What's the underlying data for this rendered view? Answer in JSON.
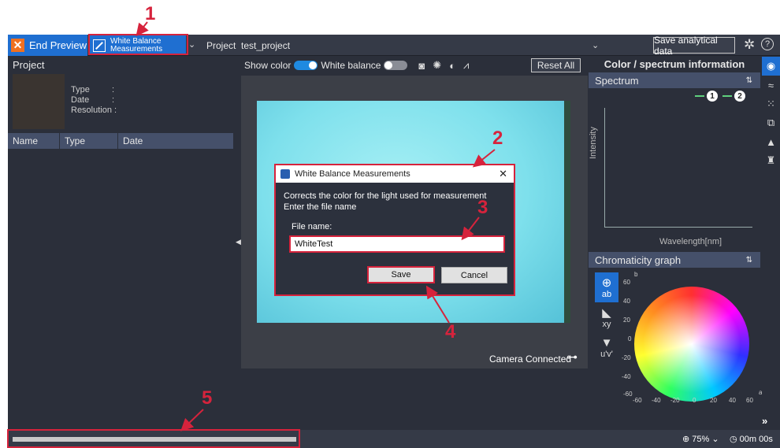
{
  "topbar": {
    "end_preview_label": "End Preview",
    "white_balance_label_line1": "White Balance",
    "white_balance_label_line2": "Measurements",
    "project_label": "Project",
    "project_name": "test_project",
    "save_analytical_label": "Save analytical data"
  },
  "left_panel": {
    "title": "Project",
    "meta": {
      "type_label": "Type",
      "date_label": "Date",
      "resolution_label": "Resolution :",
      "type_sep": ":",
      "date_sep": ":"
    },
    "table_headers": [
      "Name",
      "Type",
      "Date"
    ]
  },
  "center": {
    "show_color_label": "Show color",
    "white_balance_label": "White balance",
    "reset_all_label": "Reset All",
    "camera_status": "Camera Connected"
  },
  "dialog": {
    "title": "White Balance Measurements",
    "description_line1": "Corrects the color for the light used for measurement",
    "description_line2": "Enter the file name",
    "file_name_label": "File name:",
    "file_name_value": "WhiteTest",
    "save_label": "Save",
    "cancel_label": "Cancel"
  },
  "right_panel": {
    "title": "Color / spectrum information",
    "spectrum_heading": "Spectrum",
    "legend": [
      "1",
      "2"
    ],
    "y_label": "Intensity",
    "x_label": "Wavelength[nm]",
    "chromaticity_heading": "Chromaticity graph",
    "modes": [
      "ab",
      "xy",
      "u'v'"
    ],
    "axis_b": "b",
    "axis_a": "a",
    "y_ticks": [
      "60",
      "40",
      "20",
      "0",
      "-20",
      "-40",
      "-60"
    ],
    "x_ticks": [
      "-60",
      "-40",
      "-20",
      "0",
      "20",
      "40",
      "60"
    ]
  },
  "statusbar": {
    "progress_fraction": 1.0,
    "zoom": "75%",
    "timer": "00m 00s"
  },
  "annotations": [
    "1",
    "2",
    "3",
    "4",
    "5"
  ],
  "colors": {
    "accent": "#1f6fd1",
    "annotation_red": "#d6233c",
    "end_preview_orange": "#f07020"
  }
}
